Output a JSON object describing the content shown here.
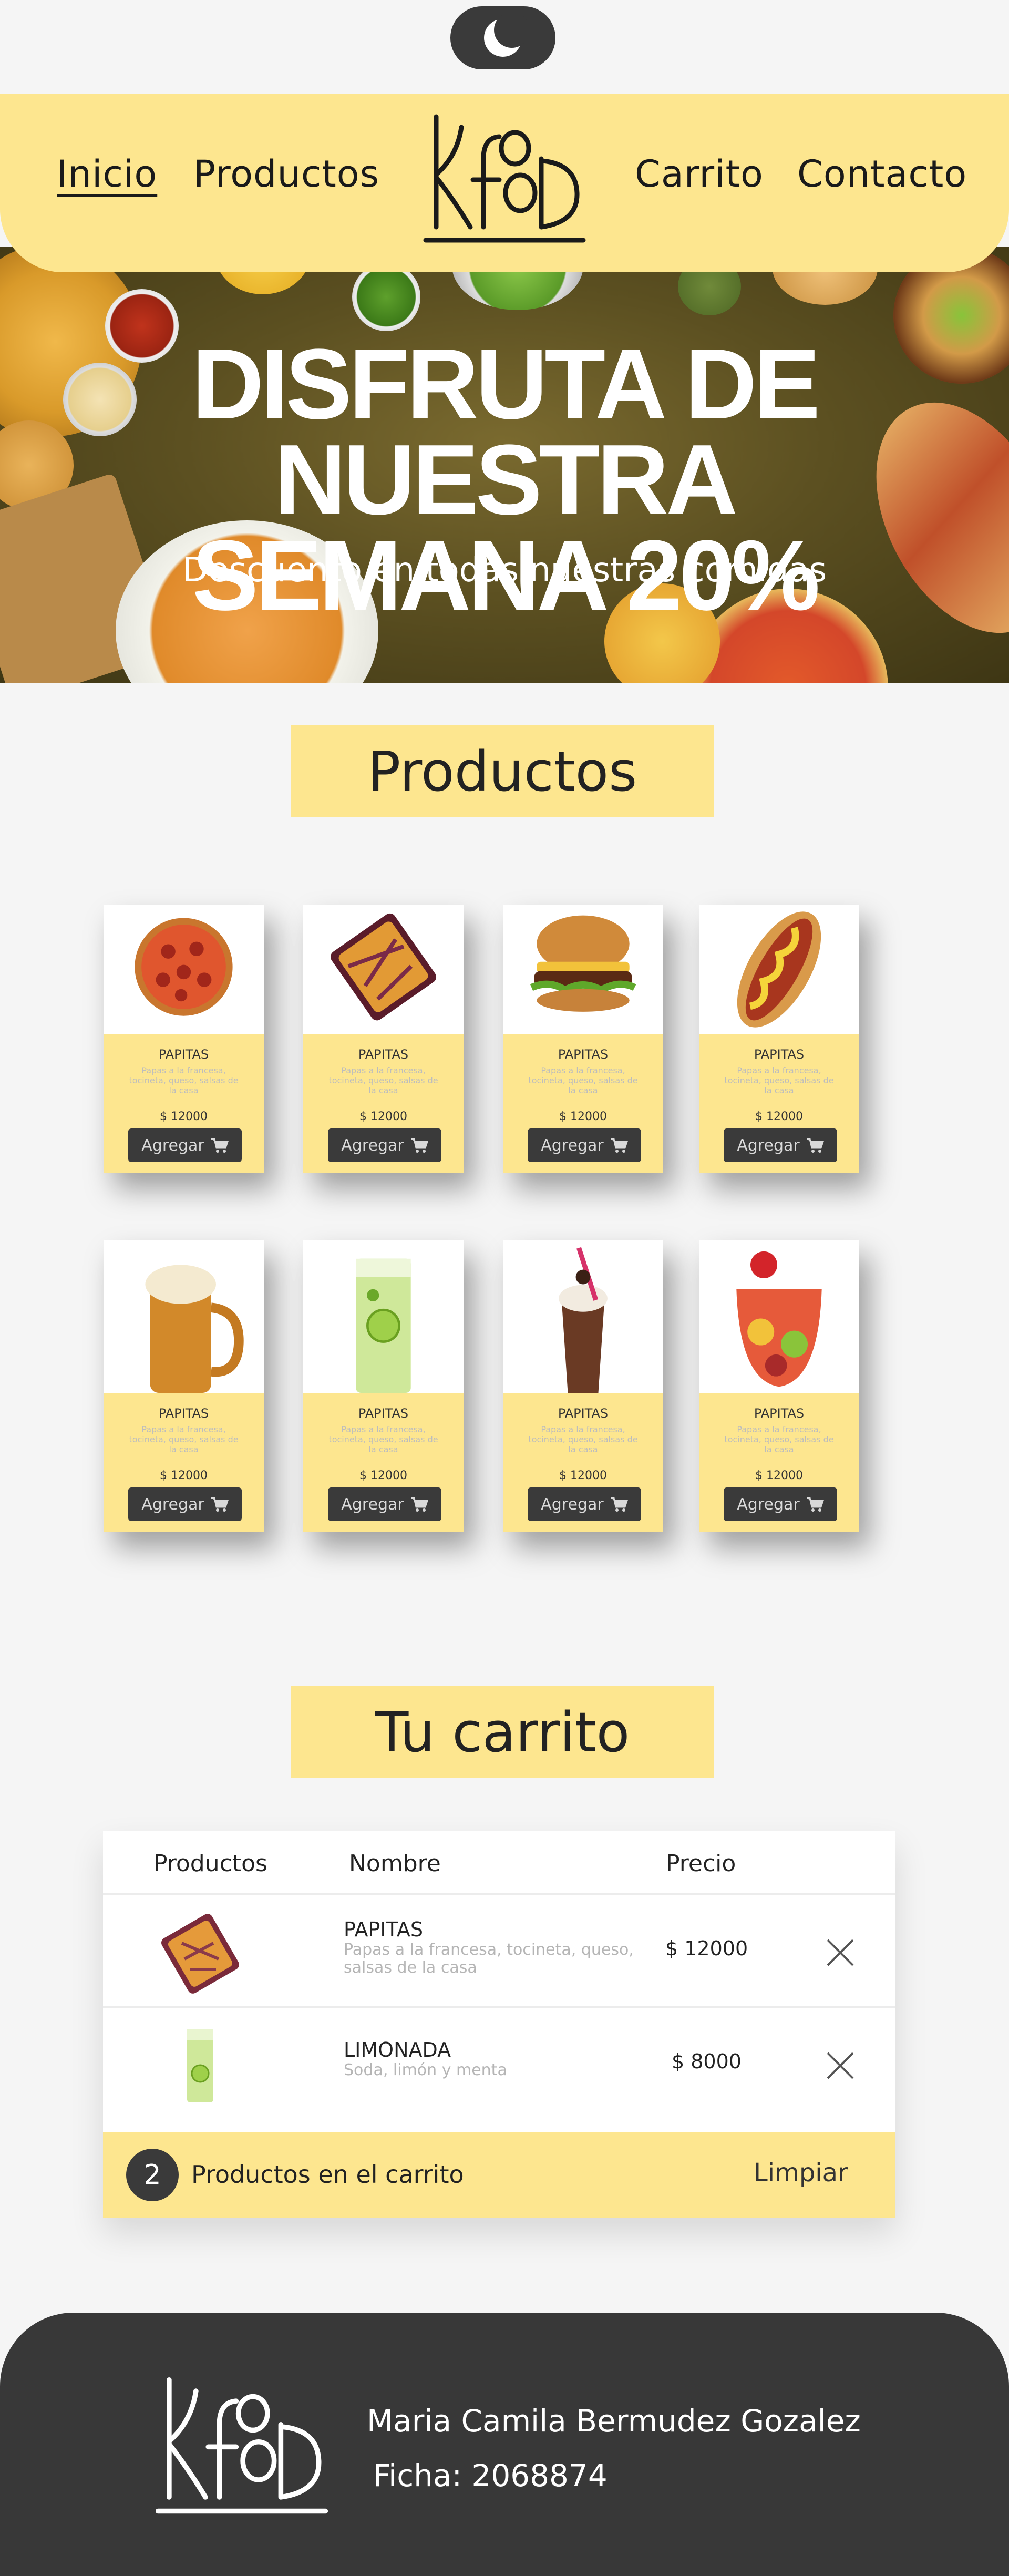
{
  "theme_toggle": {
    "icon": "moon-icon"
  },
  "nav": {
    "left": [
      {
        "label": "Inicio",
        "active": true
      },
      {
        "label": "Productos",
        "active": false
      }
    ],
    "right": [
      {
        "label": "Carrito"
      },
      {
        "label": "Contacto"
      }
    ],
    "logo_text": "KFOOD"
  },
  "hero": {
    "title_line1": "DISFRUTA DE NUESTRA",
    "title_line2": "SEMANA 20%",
    "subtitle": "Descuento en todas nuestras comidas"
  },
  "products_section": {
    "title": "Productos",
    "items": [
      {
        "image": "pizza",
        "name": "PAPITAS",
        "desc": "Papas a la francesa, tocineta, queso, salsas de la casa",
        "price": "$ 12000",
        "button": "Agregar"
      },
      {
        "image": "fries-loaded",
        "name": "PAPITAS",
        "desc": "Papas a la francesa, tocineta, queso, salsas de la casa",
        "price": "$ 12000",
        "button": "Agregar"
      },
      {
        "image": "burger",
        "name": "PAPITAS",
        "desc": "Papas a la francesa, tocineta, queso, salsas de la casa",
        "price": "$ 12000",
        "button": "Agregar"
      },
      {
        "image": "hotdog",
        "name": "PAPITAS",
        "desc": "Papas a la francesa, tocineta, queso, salsas de la casa",
        "price": "$ 12000",
        "button": "Agregar"
      },
      {
        "image": "beer",
        "name": "PAPITAS",
        "desc": "Papas a la francesa, tocineta, queso, salsas de la casa",
        "price": "$ 12000",
        "button": "Agregar"
      },
      {
        "image": "lemonade",
        "name": "PAPITAS",
        "desc": "Papas a la francesa, tocineta, queso, salsas de la casa",
        "price": "$ 12000",
        "button": "Agregar"
      },
      {
        "image": "milkshake",
        "name": "PAPITAS",
        "desc": "Papas a la francesa, tocineta, queso, salsas de la casa",
        "price": "$ 12000",
        "button": "Agregar"
      },
      {
        "image": "fruit-cocktail",
        "name": "PAPITAS",
        "desc": "Papas a la francesa, tocineta, queso, salsas de la casa",
        "price": "$ 12000",
        "button": "Agregar"
      }
    ]
  },
  "cart": {
    "title": "Tu carrito",
    "headers": {
      "products": "Productos",
      "name": "Nombre",
      "price": "Precio"
    },
    "rows": [
      {
        "image": "fries-loaded",
        "name": "PAPITAS",
        "desc": "Papas a la francesa, tocineta, queso, salsas de la casa",
        "price": "$ 12000"
      },
      {
        "image": "lemonade",
        "name": "LIMONADA",
        "desc": "Soda, limón y menta",
        "price": "$ 8000"
      }
    ],
    "count": "2",
    "count_label": "Productos en el carrito",
    "clear_label": "Limpiar"
  },
  "footer": {
    "name": "Maria Camila Bermudez Gozalez",
    "ficha": "Ficha: 2068874"
  },
  "colors": {
    "accent": "#fde68f",
    "dark": "#383838",
    "background": "#f5f5f5"
  }
}
